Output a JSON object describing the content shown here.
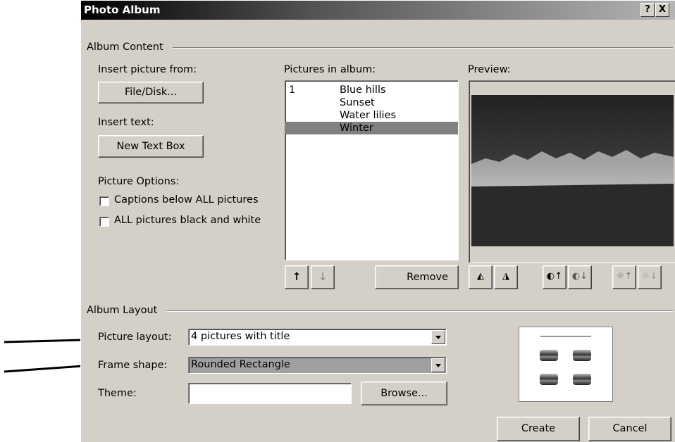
{
  "window": {
    "title": "Photo Album",
    "help_glyph": "?",
    "close_glyph": "X"
  },
  "album_content": {
    "group_label": "Album Content",
    "insert_picture_label": "Insert picture from:",
    "file_disk_button": "File/Disk...",
    "insert_text_label": "Insert text:",
    "new_text_box_button": "New Text Box",
    "picture_options_label": "Picture Options:",
    "captions_checkbox": {
      "label": "Captions below ALL pictures",
      "checked": false
    },
    "bw_checkbox": {
      "label": "ALL pictures black and white",
      "checked": false
    },
    "pictures_label": "Pictures in album:",
    "pictures": [
      {
        "index": "1",
        "name": "Blue hills",
        "selected": false
      },
      {
        "index": "",
        "name": "Sunset",
        "selected": false
      },
      {
        "index": "",
        "name": "Water lilies",
        "selected": false
      },
      {
        "index": "",
        "name": "Winter",
        "selected": true
      }
    ],
    "move_up_glyph": "↑",
    "move_down_glyph": "↓",
    "remove_button": "Remove",
    "preview_label": "Preview:"
  },
  "album_layout": {
    "group_label": "Album Layout",
    "picture_layout_label": "Picture layout:",
    "picture_layout_value": "4 pictures with title",
    "frame_shape_label": "Frame shape:",
    "frame_shape_value": "Rounded Rectangle",
    "theme_label": "Theme:",
    "theme_value": "",
    "browse_button": "Browse..."
  },
  "footer": {
    "create_button": "Create",
    "cancel_button": "Cancel"
  },
  "colors": {
    "dialog_bg": "#d4d0c8",
    "selection": "#808080"
  }
}
